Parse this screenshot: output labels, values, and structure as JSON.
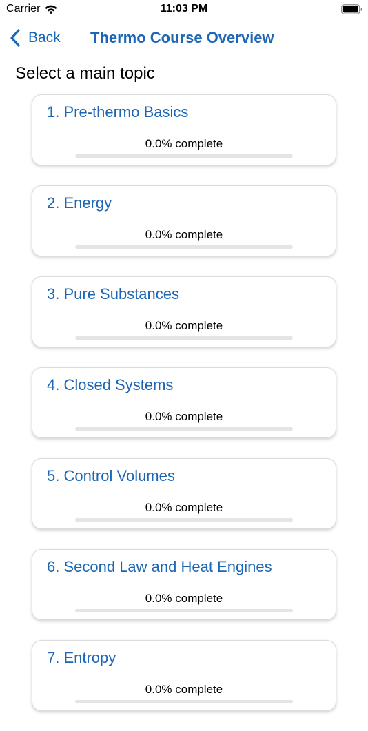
{
  "status_bar": {
    "carrier": "Carrier",
    "time": "11:03 PM"
  },
  "nav": {
    "back_label": "Back",
    "title": "Thermo Course Overview"
  },
  "section_title": "Select a main topic",
  "topics": [
    {
      "title": "1. Pre-thermo Basics",
      "progress_text": "0.0% complete",
      "progress": 0.0
    },
    {
      "title": "2. Energy",
      "progress_text": "0.0% complete",
      "progress": 0.0
    },
    {
      "title": "3. Pure Substances",
      "progress_text": "0.0% complete",
      "progress": 0.0
    },
    {
      "title": "4. Closed Systems",
      "progress_text": "0.0% complete",
      "progress": 0.0
    },
    {
      "title": "5. Control Volumes",
      "progress_text": "0.0% complete",
      "progress": 0.0
    },
    {
      "title": "6. Second Law and Heat Engines",
      "progress_text": "0.0% complete",
      "progress": 0.0
    },
    {
      "title": "7. Entropy",
      "progress_text": "0.0% complete",
      "progress": 0.0
    }
  ],
  "colors": {
    "accent": "#1d66b5",
    "track": "#e5e5e5"
  }
}
